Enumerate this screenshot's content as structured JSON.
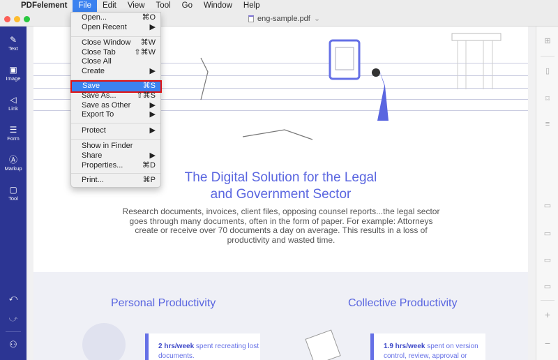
{
  "menubar": {
    "apple": "",
    "app": "PDFelement",
    "items": [
      "File",
      "Edit",
      "View",
      "Tool",
      "Go",
      "Window",
      "Help"
    ]
  },
  "window": {
    "doc_title": "eng-sample.pdf",
    "chevron": "⌄"
  },
  "sidebar": {
    "items": [
      {
        "label": "Text",
        "icon": "pencil-icon"
      },
      {
        "label": "Image",
        "icon": "image-icon"
      },
      {
        "label": "Link",
        "icon": "link-icon"
      },
      {
        "label": "Form",
        "icon": "form-icon"
      },
      {
        "label": "Markup",
        "icon": "markup-icon"
      },
      {
        "label": "Tool",
        "icon": "tool-icon"
      }
    ],
    "undo": "⤺",
    "redo": "⤻",
    "user": "user-icon"
  },
  "file_menu": {
    "items": [
      {
        "label": "Open...",
        "shortcut": "⌘O"
      },
      {
        "label": "Open Recent",
        "shortcut": "▶"
      },
      {
        "label": "Close Window",
        "shortcut": "⌘W"
      },
      {
        "label": "Close Tab",
        "shortcut": "⇧⌘W"
      },
      {
        "label": "Close All",
        "shortcut": ""
      },
      {
        "label": "Create",
        "shortcut": "▶"
      },
      {
        "label": "Save",
        "shortcut": "⌘S"
      },
      {
        "label": "Save As...",
        "shortcut": "⇧⌘S"
      },
      {
        "label": "Save as Other",
        "shortcut": "▶"
      },
      {
        "label": "Export To",
        "shortcut": "▶"
      },
      {
        "label": "Protect",
        "shortcut": "▶"
      },
      {
        "label": "Show in Finder",
        "shortcut": ""
      },
      {
        "label": "Share",
        "shortcut": "▶"
      },
      {
        "label": "Properties...",
        "shortcut": "⌘D"
      },
      {
        "label": "Print...",
        "shortcut": "⌘P"
      }
    ]
  },
  "document": {
    "title_line1": "The Digital Solution for the Legal",
    "title_line2": "and Government Sector",
    "paragraph": "Research documents, invoices, client files, opposing counsel reports...the legal sector goes through many documents, often in the form of paper. For example: Attorneys create or receive over 70 documents a day on average. This results in a loss of productivity and wasted time.",
    "left_heading": "Personal Productivity",
    "right_heading": "Collective Productivity",
    "left_card": {
      "bold": "2 hrs/week",
      "text": " spent recreating lost documents."
    },
    "right_card": {
      "bold": "1.9 hrs/week",
      "text": "  spent on version control, review, approval or"
    }
  },
  "right_panel": {
    "icons": [
      "grid-icon",
      "page-icon",
      "bookmark-icon",
      "list-icon",
      "actual-size-icon",
      "fit-width-icon",
      "fit-height-icon",
      "fit-page-icon",
      "zoom-in-icon",
      "zoom-out-icon"
    ]
  }
}
